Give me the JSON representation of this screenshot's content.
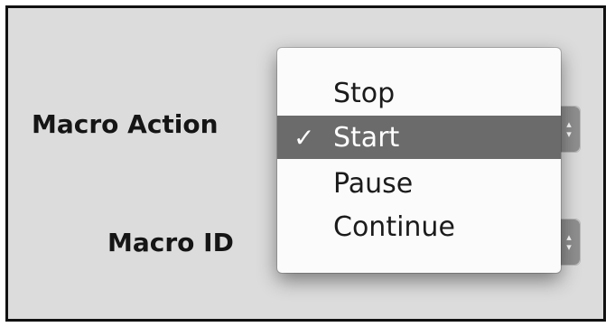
{
  "form": {
    "action_label": "Macro Action",
    "id_label": "Macro ID"
  },
  "menu": {
    "check_glyph": "✓",
    "items": [
      {
        "label": "Stop",
        "selected": false
      },
      {
        "label": "Start",
        "selected": true
      },
      {
        "label": "Pause",
        "selected": false
      },
      {
        "label": "Continue",
        "selected": false
      }
    ]
  },
  "icons": {
    "popup_arrows": "up-down-arrows-icon",
    "checkmark": "checkmark-icon"
  },
  "colors": {
    "highlight": "#6b6b6b",
    "panel": "#dcdcdc"
  }
}
